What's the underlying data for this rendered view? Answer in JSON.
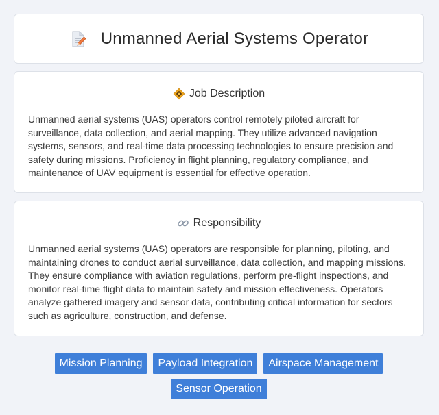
{
  "header": {
    "title": "Unmanned Aerial Systems Operator",
    "icon": "document-edit-icon"
  },
  "job_description": {
    "icon": "badge-icon",
    "heading": "Job Description",
    "text": "Unmanned aerial systems (UAS) operators control remotely piloted aircraft for surveillance, data collection, and aerial mapping. They utilize advanced navigation systems, sensors, and real-time data processing technologies to ensure precision and safety during missions. Proficiency in flight planning, regulatory compliance, and maintenance of UAV equipment is essential for effective operation."
  },
  "responsibility": {
    "icon": "link-icon",
    "heading": "Responsibility",
    "text": "Unmanned aerial systems (UAS) operators are responsible for planning, piloting, and maintaining drones to conduct aerial surveillance, data collection, and mapping missions. They ensure compliance with aviation regulations, perform pre-flight inspections, and monitor real-time flight data to maintain safety and mission effectiveness. Operators analyze gathered imagery and sensor data, contributing critical information for sectors such as agriculture, construction, and defense."
  },
  "skills": [
    "Mission Planning",
    "Payload Integration",
    "Airspace Management",
    "Sensor Operation"
  ],
  "colors": {
    "tag_background": "#3f7fd9",
    "page_background": "#f1f3f8"
  }
}
